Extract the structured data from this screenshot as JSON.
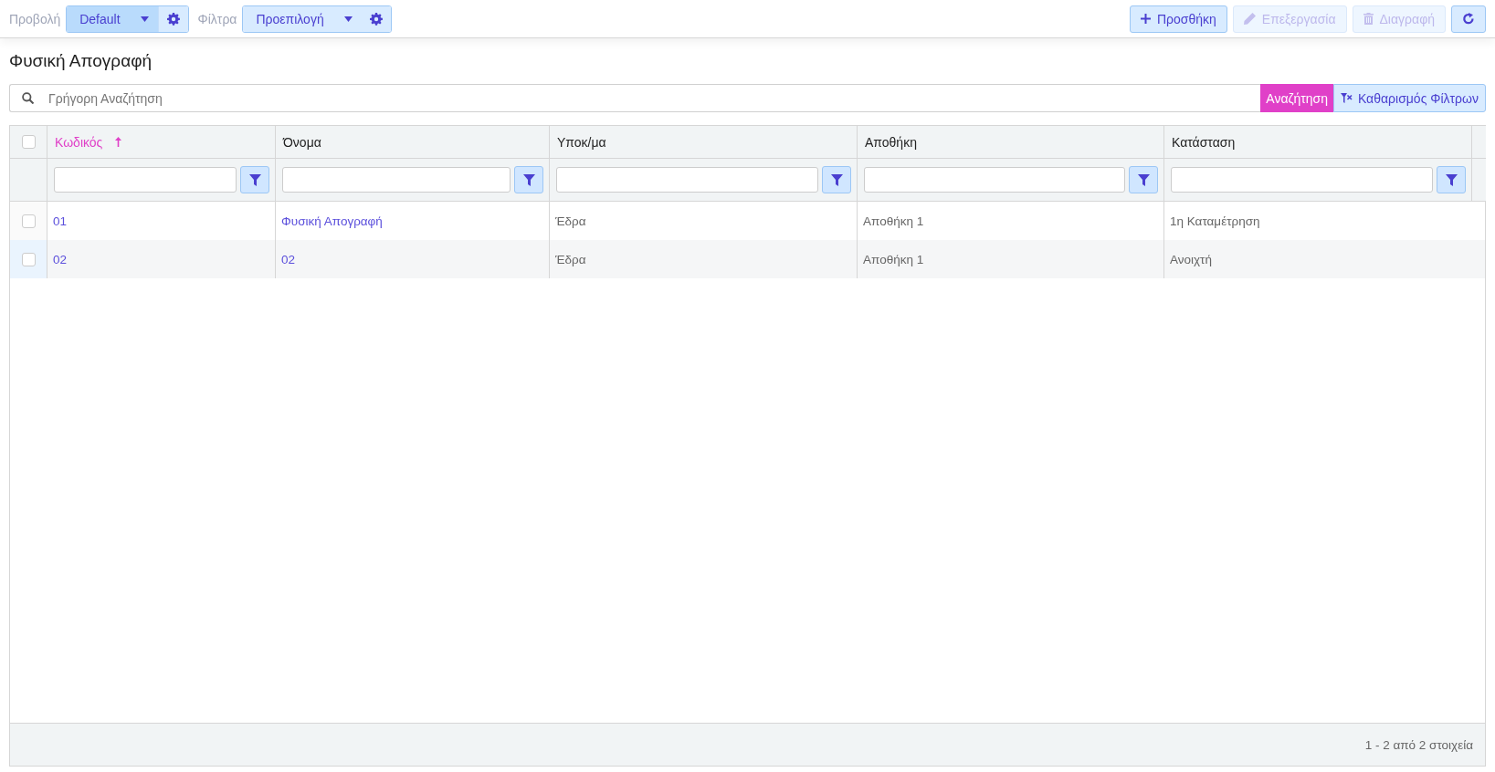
{
  "toolbar": {
    "view_label": "Προβολή",
    "view_value": "Default",
    "filters_label": "Φίλτρα",
    "filters_value": "Προεπιλογή",
    "actions": [
      {
        "kind": "add",
        "label": "Προσθήκη",
        "disabled": false
      },
      {
        "kind": "edit",
        "label": "Επεξεργασία",
        "disabled": true
      },
      {
        "kind": "delete",
        "label": "Διαγραφή",
        "disabled": true
      },
      {
        "kind": "refresh",
        "disabled": false
      }
    ]
  },
  "title": "Φυσική Απογραφή",
  "search": {
    "placeholder": "Γρήγορη Αναζήτηση",
    "search_button": "Αναζήτηση",
    "clear_button": "Καθαρισμός Φίλτρων"
  },
  "table": {
    "select_all_checked": false,
    "columns": [
      {
        "label": "Κωδικός",
        "sorted": true,
        "kind": "link"
      },
      {
        "label": "Όνομα",
        "sorted": false,
        "kind": "link"
      },
      {
        "label": "Υποκ/μα",
        "sorted": false,
        "kind": "text"
      },
      {
        "label": "Αποθήκη",
        "sorted": false,
        "kind": "text"
      },
      {
        "label": "Κατάσταση",
        "sorted": false,
        "kind": "text"
      }
    ],
    "rows": [
      {
        "checked": false,
        "cells": [
          "01",
          "Φυσική Απογραφή",
          "Έδρα",
          "Αποθήκη 1",
          "1η Καταμέτρηση"
        ]
      },
      {
        "checked": false,
        "cells": [
          "02",
          "02",
          "Έδρα",
          "Αποθήκη 1",
          "Ανοιχτή"
        ]
      }
    ],
    "footer": "1 - 2 από 2 στοιχεία"
  }
}
